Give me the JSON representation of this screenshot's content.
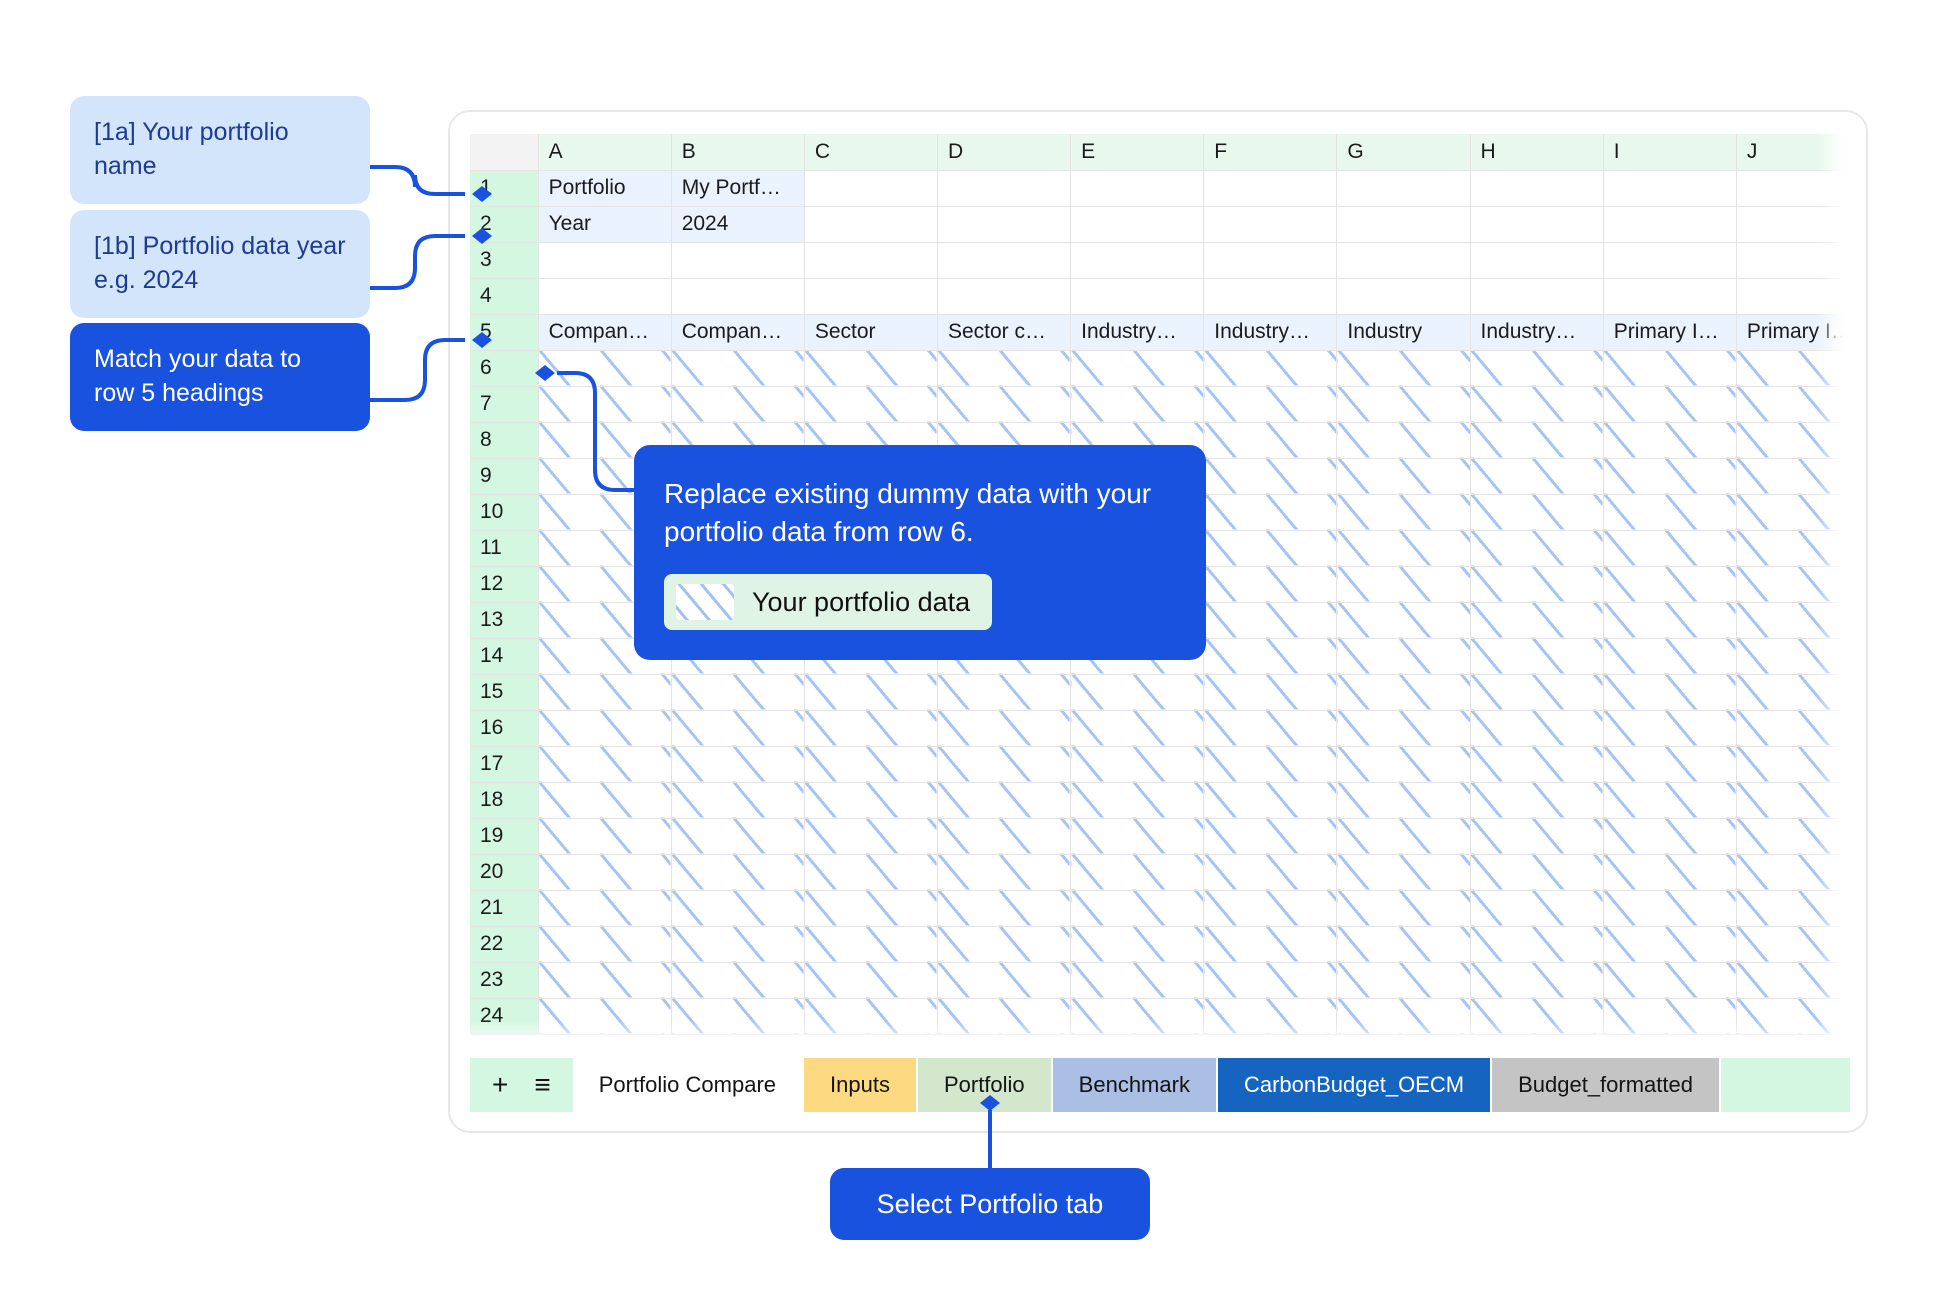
{
  "callouts": {
    "portfolio_name": "[1a] Your portfolio name",
    "portfolio_year": "[1b] Portfolio data year e.g. 2024",
    "match_headings": "Match your data to row 5 headings",
    "select_tab": "Select Portfolio tab"
  },
  "tooltip": {
    "text": "Replace existing dummy data with your portfolio data from row 6.",
    "legend_label": "Your portfolio data",
    "legend_swatch_name": "diagonal-hatch-swatch",
    "background_color": "#1a52e0"
  },
  "spreadsheet": {
    "column_headers": [
      "A",
      "B",
      "C",
      "D",
      "E",
      "F",
      "G",
      "H",
      "I",
      "J"
    ],
    "row_numbers": [
      "1",
      "2",
      "3",
      "4",
      "5",
      "6",
      "7",
      "8",
      "9",
      "10",
      "11",
      "12",
      "13",
      "14",
      "15",
      "16",
      "17",
      "18",
      "19",
      "20",
      "21",
      "22",
      "23",
      "24"
    ],
    "rows": {
      "1": [
        "Portfolio",
        "My Portf…",
        "",
        "",
        "",
        "",
        "",
        "",
        "",
        ""
      ],
      "2": [
        "Year",
        "2024",
        "",
        "",
        "",
        "",
        "",
        "",
        "",
        ""
      ],
      "3": [
        "",
        "",
        "",
        "",
        "",
        "",
        "",
        "",
        "",
        ""
      ],
      "4": [
        "",
        "",
        "",
        "",
        "",
        "",
        "",
        "",
        "",
        ""
      ],
      "5": [
        "Compan…",
        "Compan…",
        "Sector",
        "Sector c…",
        "Industry…",
        "Industry…",
        "Industry",
        "Industry…",
        "Primary I…",
        "Primary I…"
      ]
    },
    "hatched_rows_from": "6",
    "hatched_rows_to": "24",
    "colors": {
      "column_header_bg": "#e8f8ec",
      "row_header_bg": "#d4f7e2",
      "filled_cell_bg": "#eaf2fd",
      "hatch_line": "#96bbf0"
    }
  },
  "tab_bar": {
    "add_icon": "+",
    "list_icon": "≡",
    "tabs": [
      {
        "label": "Portfolio Compare",
        "bg": "#ffffff",
        "fg": "#141414"
      },
      {
        "label": "Inputs",
        "bg": "#fdd982",
        "fg": "#141414"
      },
      {
        "label": "Portfolio",
        "bg": "#d3e7cc",
        "fg": "#141414"
      },
      {
        "label": "Benchmark",
        "bg": "#aabfe3",
        "fg": "#141414"
      },
      {
        "label": "CarbonBudget_OECM",
        "bg": "#1565c0",
        "fg": "#ffffff"
      },
      {
        "label": "Budget_formatted",
        "bg": "#c4c4c4",
        "fg": "#141414"
      }
    ]
  }
}
